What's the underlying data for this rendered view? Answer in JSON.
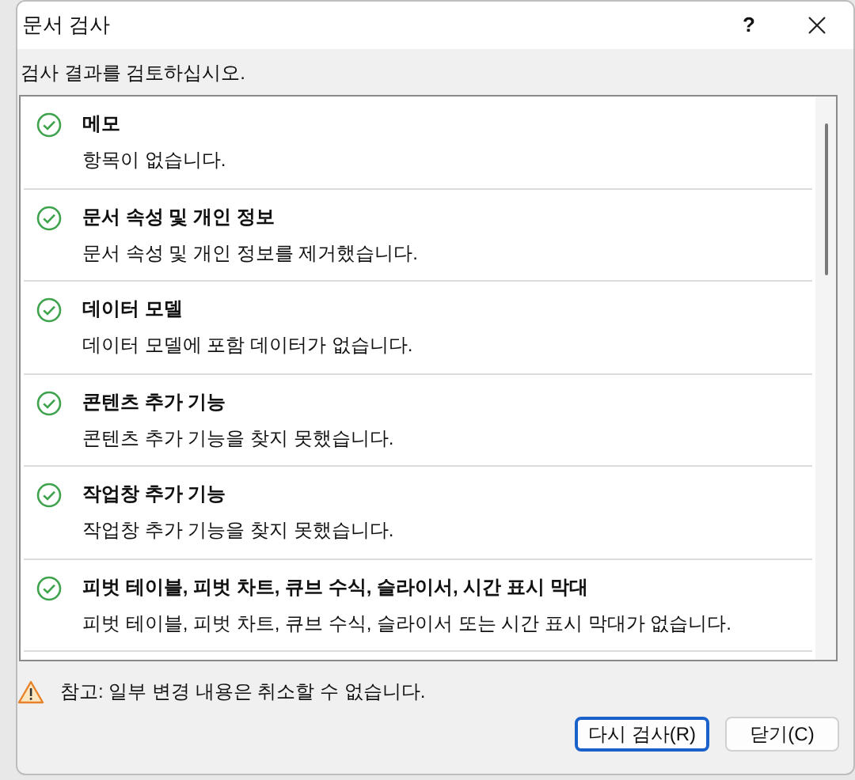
{
  "window": {
    "title": "문서 검사",
    "help": "?"
  },
  "instruction": "검사 결과를 검토하십시오.",
  "results": [
    {
      "kind": "passed",
      "title": "메모",
      "detail": "항목이 없습니다."
    },
    {
      "kind": "passed",
      "title": "문서 속성 및 개인 정보",
      "detail": "문서 속성 및 개인 정보를 제거했습니다."
    },
    {
      "kind": "passed",
      "title": "데이터 모델",
      "detail": "데이터 모델에 포함 데이터가 없습니다."
    },
    {
      "kind": "passed",
      "title": "콘텐츠 추가 기능",
      "detail": "콘텐츠 추가 기능을 찾지 못했습니다."
    },
    {
      "kind": "passed",
      "title": "작업창 추가 기능",
      "detail": "작업창 추가 기능을 찾지 못했습니다."
    },
    {
      "kind": "passed",
      "title": "피벗 테이블, 피벗 차트, 큐브 수식, 슬라이서, 시간 표시 막대",
      "detail": "피벗 테이블, 피벗 차트, 큐브 수식, 슬라이서 또는 시간 표시 막대가 없습니다."
    }
  ],
  "note": "참고: 일부 변경 내용은 취소할 수 없습니다.",
  "buttons": [
    {
      "label": "다시 검사(R)",
      "focused": true
    },
    {
      "label": "닫기(C)",
      "focused": false
    }
  ]
}
